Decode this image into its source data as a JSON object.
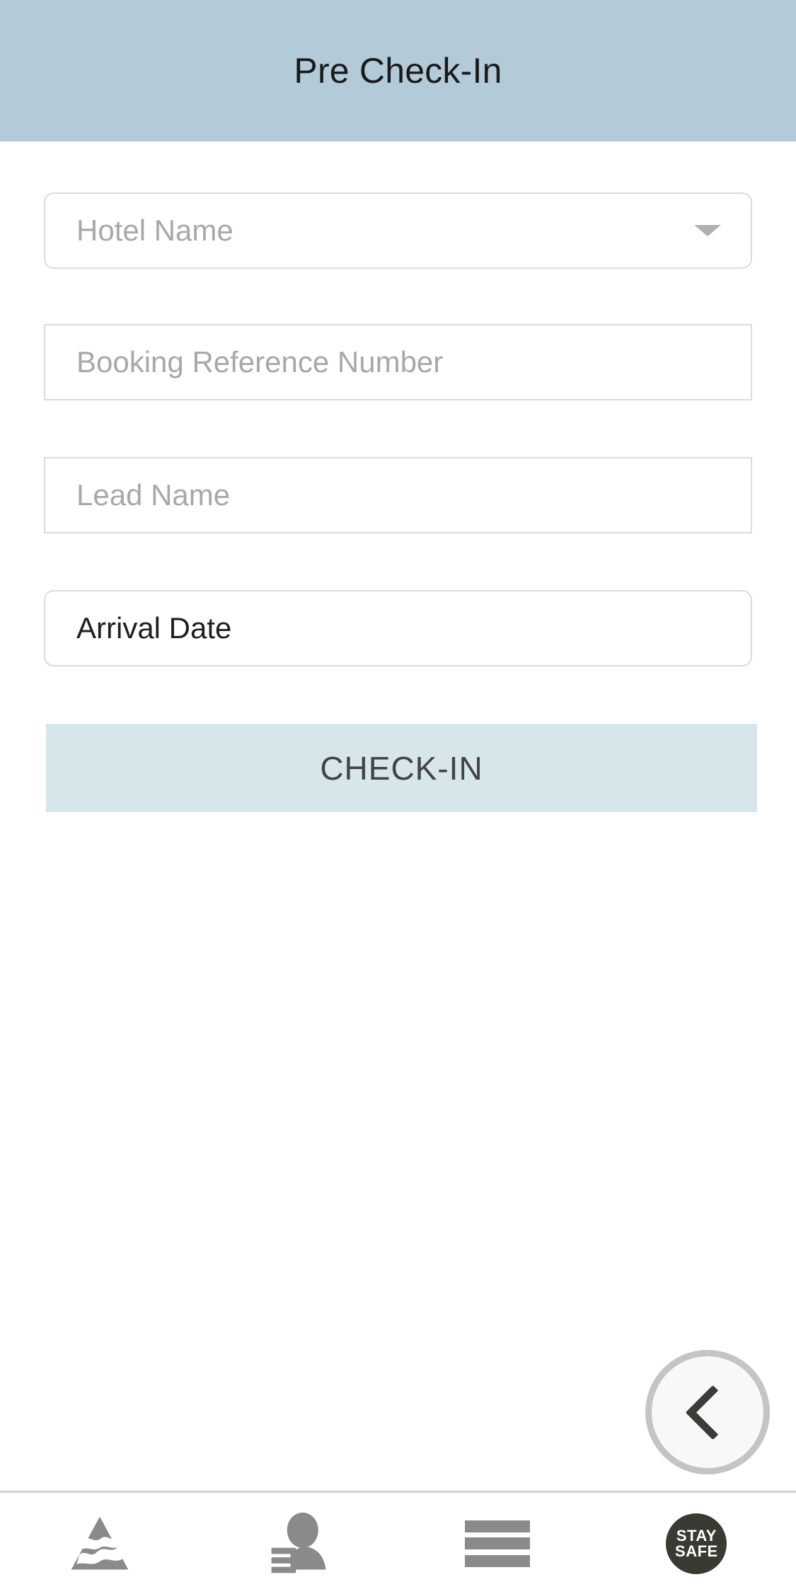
{
  "header": {
    "title": "Pre Check-In",
    "background_color": "#b3cbd8"
  },
  "form": {
    "fields": [
      {
        "name": "hotel-name",
        "placeholder": "Hotel Name",
        "value": "",
        "display_text": "Hotel Name",
        "filled": false,
        "has_dropdown": true,
        "rounded": true
      },
      {
        "name": "booking-reference-number",
        "placeholder": "Booking Reference Number",
        "value": "",
        "display_text": "Booking Reference Number",
        "filled": false,
        "has_dropdown": false,
        "rounded": false
      },
      {
        "name": "lead-name",
        "placeholder": "Lead Name",
        "value": "",
        "display_text": "Lead Name",
        "filled": false,
        "has_dropdown": false,
        "rounded": false
      },
      {
        "name": "arrival-date",
        "placeholder": "Arrival Date",
        "value": "Arrival Date",
        "display_text": "Arrival Date",
        "filled": true,
        "has_dropdown": false,
        "rounded": true
      }
    ],
    "submit": {
      "label": "CHECK-IN",
      "background_color": "#d7e6ea",
      "text_color": "#434343"
    }
  },
  "floating_action": {
    "name": "back-button",
    "icon": "chevron-left-icon"
  },
  "bottom_nav": {
    "items": [
      {
        "name": "home",
        "icon": "mountain-logo-icon",
        "label": ""
      },
      {
        "name": "profile",
        "icon": "person-profile-icon",
        "label": ""
      },
      {
        "name": "menu",
        "icon": "hamburger-menu-icon",
        "label": ""
      },
      {
        "name": "stay-safe",
        "icon": "stay-safe-badge-icon",
        "label_line1": "STAY",
        "label_line2": "SAFE"
      }
    ],
    "icon_color": "#8a8a8a",
    "badge_color": "#3a3a33"
  }
}
